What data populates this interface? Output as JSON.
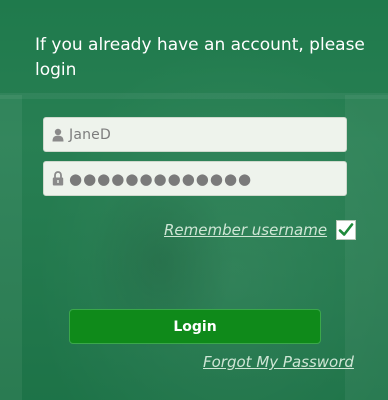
{
  "login_panel": {
    "heading": "If you already have an account, please login",
    "username": {
      "value": "JaneD",
      "icon": "user-icon"
    },
    "password": {
      "value": "●●●●●●●●●●●●●",
      "icon": "lock-icon"
    },
    "remember": {
      "label": "Remember username",
      "checked": true
    },
    "login_button": {
      "label": "Login"
    },
    "forgot_link": {
      "label": "Forgot My Password"
    }
  },
  "colors": {
    "panel_background": "#1f7a4c",
    "button": "#0f8a1a",
    "link_text": "#cfe6d5",
    "input_background": "#eef3ec",
    "checkmark": "#1f8a3a"
  }
}
